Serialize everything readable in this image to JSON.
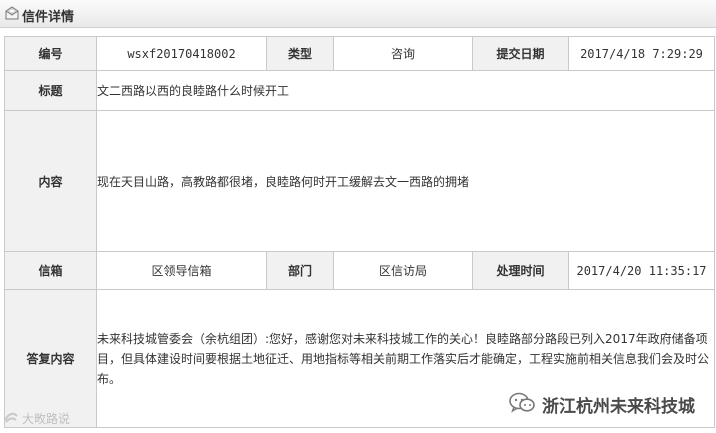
{
  "header": {
    "title": "信件详情",
    "icon": "envelope-icon"
  },
  "fields": {
    "number": {
      "label": "编号",
      "value": "wsxf20170418002"
    },
    "type": {
      "label": "类型",
      "value": "咨询"
    },
    "submit_date": {
      "label": "提交日期",
      "value": "2017/4/18 7:29:29"
    },
    "subject": {
      "label": "标题",
      "value": "文二西路以西的良睦路什么时候开工"
    },
    "content": {
      "label": "内容",
      "value": "现在天目山路，高教路都很堵，良睦路何时开工缓解去文一西路的拥堵"
    },
    "mailbox": {
      "label": "信箱",
      "value": "区领导信箱"
    },
    "department": {
      "label": "部门",
      "value": "区信访局"
    },
    "processed_time": {
      "label": "处理时间",
      "value": "2017/4/20 11:35:17"
    },
    "reply": {
      "label": "答复内容",
      "value": "未来科技城管委会（余杭组团）:您好，感谢您对未来科技城工作的关心！良睦路部分路段已列入2017年政府储备项目，但具体建设时间要根据土地征迁、用地指标等相关前期工作落实后才能确定，工程实施前相关信息我们会及时公布。"
    }
  },
  "watermarks": {
    "left": "大畋路说",
    "right": "浙江杭州未来科技城"
  }
}
